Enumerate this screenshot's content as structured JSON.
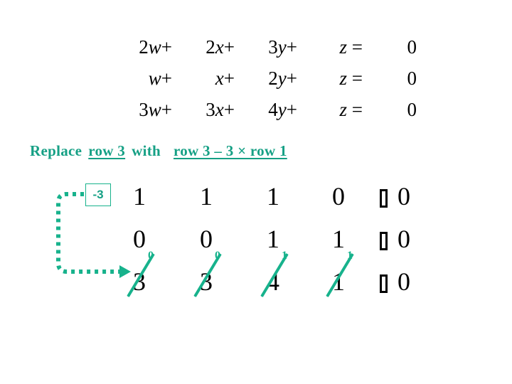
{
  "slide": {
    "background_color": "#FFFFFF",
    "accent_color": "#16A085",
    "text_color": "#000000"
  },
  "equations": {
    "rows": [
      {
        "w": "2w+",
        "x": "2x+",
        "y": "3y+",
        "z": "z =",
        "rhs": "0"
      },
      {
        "w": "w+",
        "x": "x+",
        "y": "2y+",
        "z": "z =",
        "rhs": "0"
      },
      {
        "w": "3w+",
        "x": "3x+",
        "y": "4y+",
        "z": "z =",
        "rhs": "0"
      }
    ]
  },
  "instruction": {
    "lead": "Replace",
    "target_row": "row 3",
    "connector": "with",
    "operation": "row 3 –  3 × row 1"
  },
  "multiplier": {
    "label": "-3"
  },
  "matrix": {
    "bar_glyph": "missing-glyph-box",
    "rows": [
      {
        "cells": [
          "1",
          "1",
          "1",
          "0"
        ],
        "rhs": "0",
        "struck": false,
        "new_cells": []
      },
      {
        "cells": [
          "0",
          "0",
          "1",
          "1"
        ],
        "rhs": "0",
        "struck": false,
        "new_cells": []
      },
      {
        "cells": [
          "3",
          "3",
          "4",
          "1"
        ],
        "rhs": "0",
        "struck": true,
        "new_cells": [
          "0",
          "0",
          "1",
          "1"
        ]
      }
    ]
  }
}
